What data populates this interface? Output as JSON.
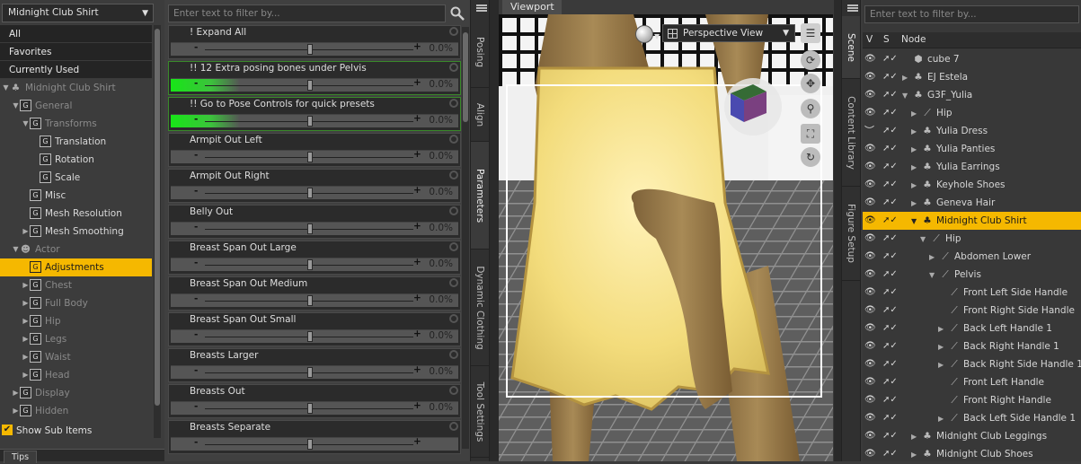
{
  "left_panel": {
    "combo_value": "Midnight Club Shirt",
    "categories": [
      "All",
      "Favorites",
      "Currently Used"
    ],
    "tree": [
      {
        "label": "Midnight Club Shirt",
        "indent": 0,
        "kind": "figure",
        "expand": "down",
        "dim": true
      },
      {
        "label": "General",
        "indent": 1,
        "kind": "group",
        "expand": "down",
        "dim": true
      },
      {
        "label": "Transforms",
        "indent": 2,
        "kind": "group",
        "expand": "down",
        "dim": true
      },
      {
        "label": "Translation",
        "indent": 3,
        "kind": "group",
        "expand": "",
        "dim": false
      },
      {
        "label": "Rotation",
        "indent": 3,
        "kind": "group",
        "expand": "",
        "dim": false
      },
      {
        "label": "Scale",
        "indent": 3,
        "kind": "group",
        "expand": "",
        "dim": false
      },
      {
        "label": "Misc",
        "indent": 2,
        "kind": "group",
        "expand": "",
        "dim": false
      },
      {
        "label": "Mesh Resolution",
        "indent": 2,
        "kind": "group",
        "expand": "",
        "dim": false
      },
      {
        "label": "Mesh Smoothing",
        "indent": 2,
        "kind": "group",
        "expand": "right",
        "dim": false
      },
      {
        "label": "Actor",
        "indent": 1,
        "kind": "actor",
        "expand": "down",
        "dim": true
      },
      {
        "label": "Adjustments",
        "indent": 2,
        "kind": "group",
        "expand": "",
        "dim": false,
        "selected": true
      },
      {
        "label": "Chest",
        "indent": 2,
        "kind": "group",
        "expand": "right",
        "dim": true
      },
      {
        "label": "Full Body",
        "indent": 2,
        "kind": "group",
        "expand": "right",
        "dim": true
      },
      {
        "label": "Hip",
        "indent": 2,
        "kind": "group",
        "expand": "right",
        "dim": true
      },
      {
        "label": "Legs",
        "indent": 2,
        "kind": "group",
        "expand": "right",
        "dim": true
      },
      {
        "label": "Waist",
        "indent": 2,
        "kind": "group",
        "expand": "right",
        "dim": true
      },
      {
        "label": "Head",
        "indent": 2,
        "kind": "group",
        "expand": "right",
        "dim": true
      },
      {
        "label": "Display",
        "indent": 1,
        "kind": "group",
        "expand": "right",
        "dim": true
      },
      {
        "label": "Hidden",
        "indent": 1,
        "kind": "group",
        "expand": "right",
        "dim": true
      }
    ],
    "group_glyph": "G",
    "show_sub_items": "Show Sub Items",
    "tips_tab": "Tips"
  },
  "params_panel": {
    "filter_placeholder": "Enter text to filter by...",
    "params": [
      {
        "label": "! Expand All",
        "value": "0.0%",
        "highlight": 0
      },
      {
        "label": "!! 12 Extra posing bones under Pelvis",
        "value": "0.0%",
        "highlight": 1
      },
      {
        "label": "!! Go to Pose Controls for quick presets",
        "value": "0.0%",
        "highlight": 1
      },
      {
        "label": "Armpit Out Left",
        "value": "0.0%",
        "highlight": 0
      },
      {
        "label": "Armpit Out Right",
        "value": "0.0%",
        "highlight": 0
      },
      {
        "label": "Belly Out",
        "value": "0.0%",
        "highlight": 0
      },
      {
        "label": "Breast Span Out Large",
        "value": "0.0%",
        "highlight": 0
      },
      {
        "label": "Breast Span Out Medium",
        "value": "0.0%",
        "highlight": 0
      },
      {
        "label": "Breast Span Out Small",
        "value": "0.0%",
        "highlight": 0
      },
      {
        "label": "Breasts Larger",
        "value": "0.0%",
        "highlight": 0
      },
      {
        "label": "Breasts Out",
        "value": "0.0%",
        "highlight": 0
      },
      {
        "label": "Breasts Separate",
        "value": "",
        "highlight": 0
      }
    ],
    "minus": "-",
    "plus": "+"
  },
  "tabs_mid": [
    "Posing",
    "Align",
    "Parameters",
    "Dynamic Clothing",
    "Tool Settings"
  ],
  "tabs_mid_active": "Parameters",
  "viewport": {
    "tab": "Viewport",
    "camera": "Perspective View"
  },
  "tabs_right": [
    "Scene",
    "Content Library",
    "Figure Setup"
  ],
  "tabs_right_active": "Scene",
  "scene_panel": {
    "filter_placeholder": "Enter text to filter by...",
    "headers": {
      "v": "V",
      "s": "S",
      "node": "Node"
    },
    "rows": [
      {
        "label": "cube 7",
        "indent": 0,
        "expand": "",
        "icon": "cube",
        "eye": "open"
      },
      {
        "label": "EJ Estela",
        "indent": 0,
        "expand": "right",
        "icon": "figure",
        "eye": "open"
      },
      {
        "label": "G3F_Yulia",
        "indent": 0,
        "expand": "down",
        "icon": "figure",
        "eye": "open"
      },
      {
        "label": "Hip",
        "indent": 1,
        "expand": "right",
        "icon": "bone",
        "eye": "open"
      },
      {
        "label": "Yulia Dress",
        "indent": 1,
        "expand": "right",
        "icon": "figure",
        "eye": "closed"
      },
      {
        "label": "Yulia Panties",
        "indent": 1,
        "expand": "right",
        "icon": "figure",
        "eye": "open"
      },
      {
        "label": "Yulia Earrings",
        "indent": 1,
        "expand": "right",
        "icon": "figure",
        "eye": "open"
      },
      {
        "label": "Keyhole Shoes",
        "indent": 1,
        "expand": "right",
        "icon": "figure",
        "eye": "open"
      },
      {
        "label": "Geneva Hair",
        "indent": 1,
        "expand": "right",
        "icon": "figure",
        "eye": "open"
      },
      {
        "label": "Midnight Club Shirt",
        "indent": 1,
        "expand": "down",
        "icon": "figure",
        "eye": "open",
        "selected": true
      },
      {
        "label": "Hip",
        "indent": 2,
        "expand": "down",
        "icon": "bone",
        "eye": "open"
      },
      {
        "label": "Abdomen Lower",
        "indent": 3,
        "expand": "right",
        "icon": "bone",
        "eye": "open"
      },
      {
        "label": "Pelvis",
        "indent": 3,
        "expand": "down",
        "icon": "bone",
        "eye": "open"
      },
      {
        "label": "Front Left Side Handle",
        "indent": 4,
        "expand": "",
        "icon": "bone",
        "eye": "open"
      },
      {
        "label": "Front Right Side Handle",
        "indent": 4,
        "expand": "",
        "icon": "bone",
        "eye": "open"
      },
      {
        "label": "Back Left Handle 1",
        "indent": 4,
        "expand": "right",
        "icon": "bone",
        "eye": "open"
      },
      {
        "label": "Back Right Handle 1",
        "indent": 4,
        "expand": "right",
        "icon": "bone",
        "eye": "open"
      },
      {
        "label": "Back Right Side Handle 1",
        "indent": 4,
        "expand": "right",
        "icon": "bone",
        "eye": "open"
      },
      {
        "label": "Front Left Handle",
        "indent": 4,
        "expand": "",
        "icon": "bone",
        "eye": "open"
      },
      {
        "label": "Front Right Handle",
        "indent": 4,
        "expand": "",
        "icon": "bone",
        "eye": "open"
      },
      {
        "label": "Back Left Side Handle 1",
        "indent": 4,
        "expand": "right",
        "icon": "bone",
        "eye": "open"
      },
      {
        "label": "Midnight Club Leggings",
        "indent": 1,
        "expand": "right",
        "icon": "figure",
        "eye": "open"
      },
      {
        "label": "Midnight Club Shoes",
        "indent": 1,
        "expand": "right",
        "icon": "figure",
        "eye": "open"
      }
    ]
  },
  "colors": {
    "selection": "#f5b800",
    "highlight_green": "#17e617"
  }
}
